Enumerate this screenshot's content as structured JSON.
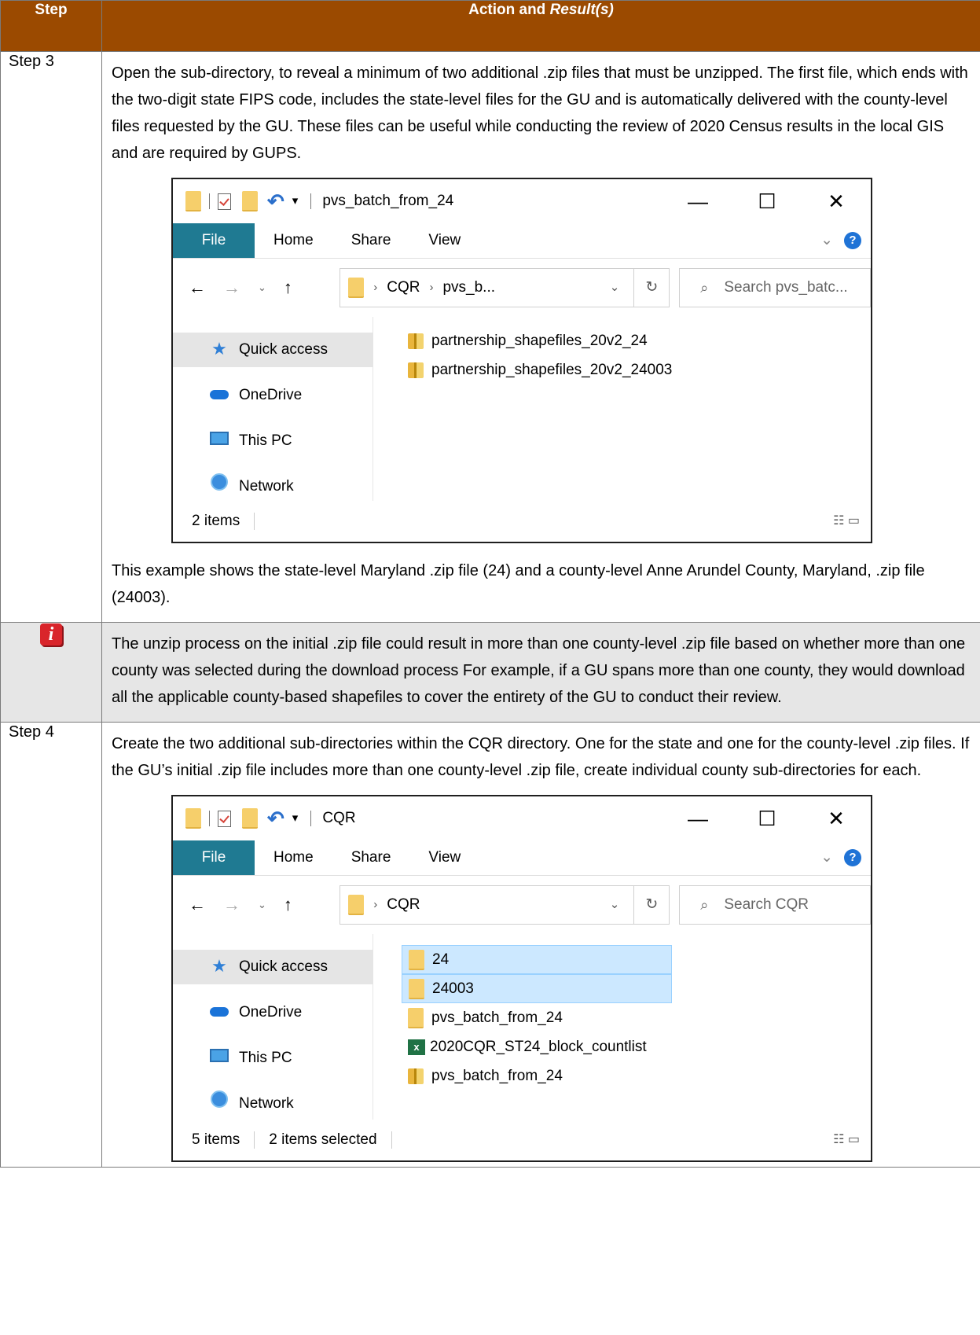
{
  "header": {
    "step": "Step",
    "action": "Action and",
    "result": "Result(s)"
  },
  "row1": {
    "step": "Step 3",
    "text1": "Open the sub-directory, to reveal a minimum of two additional .zip files that must be unzipped. The first file, which ends with the two-digit state FIPS code, includes the state-level files for the GU and is automatically delivered with the county-level files requested by the GU. These files can be useful while conducting the review of 2020 Census results in the local GIS and are required by GUPS.",
    "text2": "This example shows the state-level Maryland .zip file (24) and a county-level Anne Arundel County, Maryland, .zip file (24003).",
    "window": {
      "title": "pvs_batch_from_24",
      "tabs": [
        "File",
        "Home",
        "Share",
        "View"
      ],
      "path1": "CQR",
      "path2": "pvs_b...",
      "search": "Search pvs_batc...",
      "nav": [
        "Quick access",
        "OneDrive",
        "This PC",
        "Network"
      ],
      "files": [
        "partnership_shapefiles_20v2_24",
        "partnership_shapefiles_20v2_24003"
      ],
      "status": "2 items"
    }
  },
  "note": {
    "text": "The unzip process on the initial .zip file could result in more than one county-level .zip file based on whether more than one county was selected during the download process For example, if a GU spans more than one county, they would download all the applicable county-based shapefiles to cover the entirety of the GU to conduct their review."
  },
  "row2": {
    "step": "Step 4",
    "text1": "Create the two additional sub-directories within the CQR directory. One for the state and one for the county-level .zip files. If the GU’s initial .zip file includes more than one county-level .zip file, create individual county sub-directories for each.",
    "window": {
      "title": "CQR",
      "tabs": [
        "File",
        "Home",
        "Share",
        "View"
      ],
      "path1": "CQR",
      "search": "Search CQR",
      "nav": [
        "Quick access",
        "OneDrive",
        "This PC",
        "Network"
      ],
      "files": [
        "24",
        "24003",
        "pvs_batch_from_24",
        "2020CQR_ST24_block_countlist",
        "pvs_batch_from_24"
      ],
      "status": "5 items",
      "status_sel": "2 items selected"
    }
  }
}
